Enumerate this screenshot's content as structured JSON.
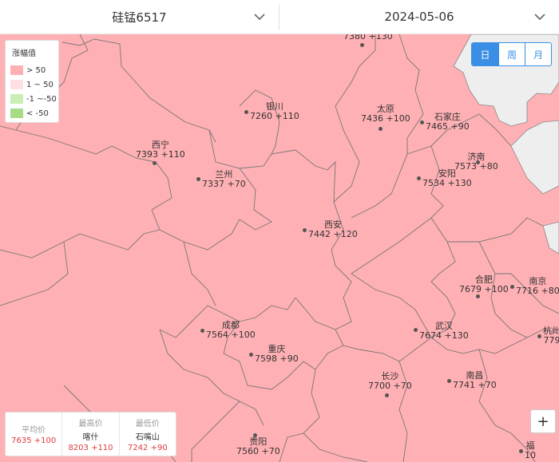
{
  "header": {
    "product": "硅锰6517",
    "date": "2024-05-06"
  },
  "legend": {
    "title": "涨幅值",
    "items": [
      {
        "label": "> 50",
        "color": "#ffb0b4"
      },
      {
        "label": "1 ~ 50",
        "color": "#ffe0e2"
      },
      {
        "label": "-1 ~-50",
        "color": "#c9efb3"
      },
      {
        "label": "< -50",
        "color": "#a7dc86"
      }
    ]
  },
  "periods": [
    {
      "label": "日",
      "active": true
    },
    {
      "label": "周",
      "active": false
    },
    {
      "label": "月",
      "active": false
    }
  ],
  "cities": [
    {
      "name": "",
      "value": "7380 +130"
    },
    {
      "name": "银川",
      "value": "7260 +110"
    },
    {
      "name": "太原",
      "value": "7436 +100"
    },
    {
      "name": "石家庄",
      "value": "7465 +90"
    },
    {
      "name": "西宁",
      "value": "7393 +110"
    },
    {
      "name": "济南",
      "value": "7573 +80"
    },
    {
      "name": "兰州",
      "value": "7337 +70"
    },
    {
      "name": "安阳",
      "value": "7534 +130"
    },
    {
      "name": "西安",
      "value": "7442 +120"
    },
    {
      "name": "合肥",
      "value": "7679 +100"
    },
    {
      "name": "南京",
      "value": "7716 +80"
    },
    {
      "name": "成都",
      "value": "7564 +100"
    },
    {
      "name": "武汉",
      "value": "7674 +130"
    },
    {
      "name": "杭州",
      "value": "779"
    },
    {
      "name": "重庆",
      "value": "7598 +90"
    },
    {
      "name": "长沙",
      "value": "7700 +70"
    },
    {
      "name": "南昌",
      "value": "7741 +70"
    },
    {
      "name": "贵阳",
      "value": "7560 +70"
    },
    {
      "name": "福",
      "value": "10"
    }
  ],
  "stats": {
    "avg": {
      "label": "平均价",
      "value": "7635 +100"
    },
    "max": {
      "label": "最高价",
      "city": "喀什",
      "value": "8203 +110"
    },
    "min": {
      "label": "最低价",
      "city": "石嘴山",
      "value": "7242 +90"
    }
  },
  "zoom": {
    "plus": "+"
  }
}
